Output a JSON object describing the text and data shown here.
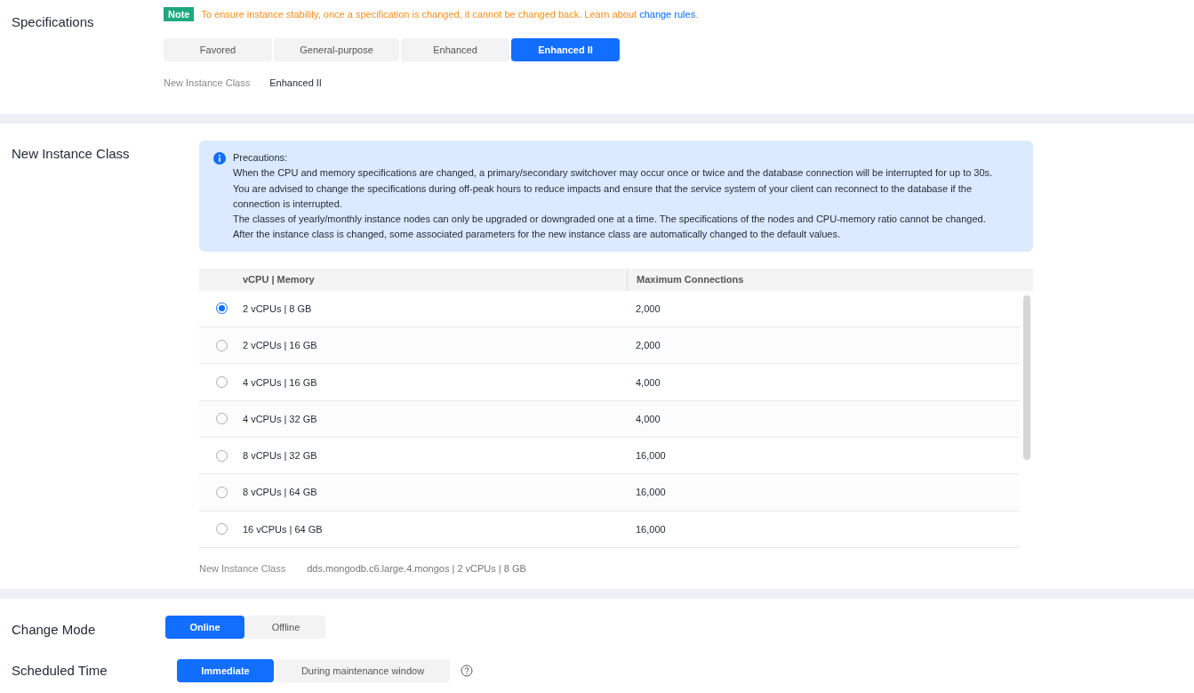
{
  "specifications": {
    "label": "Specifications",
    "note": {
      "badge": "Note",
      "text": "To ensure instance stability, once a specification is changed, it cannot be changed back. Learn about",
      "link": "change rules",
      "end": "."
    },
    "tabs": [
      {
        "label": "Favored",
        "selected": false
      },
      {
        "label": "General-purpose",
        "selected": false
      },
      {
        "label": "Enhanced",
        "selected": false
      },
      {
        "label": "Enhanced II",
        "selected": true
      }
    ],
    "summary": {
      "label": "New Instance Class",
      "value": "Enhanced II"
    }
  },
  "instance_class": {
    "label": "New Instance Class",
    "precautions": {
      "title": "Precautions:",
      "lines": [
        "When the CPU and memory specifications are changed, a primary/secondary switchover may occur once or twice and the database connection will be interrupted for up to 30s.",
        "You are advised to change the specifications during off-peak hours to reduce impacts and ensure that the service system of your client can reconnect to the database if the connection is interrupted.",
        "The classes of yearly/monthly instance nodes can only be upgraded or downgraded one at a time. The specifications of the nodes and CPU-memory ratio cannot be changed.",
        "After the instance class is changed, some associated parameters for the new instance class are automatically changed to the default values."
      ]
    },
    "table": {
      "columns": [
        "vCPU | Memory",
        "Maximum Connections"
      ],
      "rows": [
        {
          "spec": "2 vCPUs | 8 GB",
          "connections": "2,000",
          "selected": true
        },
        {
          "spec": "2 vCPUs | 16 GB",
          "connections": "2,000",
          "selected": false
        },
        {
          "spec": "4 vCPUs | 16 GB",
          "connections": "4,000",
          "selected": false
        },
        {
          "spec": "4 vCPUs | 32 GB",
          "connections": "4,000",
          "selected": false
        },
        {
          "spec": "8 vCPUs | 32 GB",
          "connections": "16,000",
          "selected": false
        },
        {
          "spec": "8 vCPUs | 64 GB",
          "connections": "16,000",
          "selected": false
        },
        {
          "spec": "16 vCPUs | 64 GB",
          "connections": "16,000",
          "selected": false
        }
      ]
    },
    "summary": {
      "label": "New Instance Class",
      "value": "dds.mongodb.c6.large.4.mongos | 2 vCPUs | 8 GB"
    }
  },
  "change_mode": {
    "label": "Change Mode",
    "options": [
      {
        "label": "Online",
        "selected": true
      },
      {
        "label": "Offline",
        "selected": false
      }
    ]
  },
  "scheduled_time": {
    "label": "Scheduled Time",
    "options": [
      {
        "label": "Immediate",
        "selected": true
      },
      {
        "label": "During maintenance window",
        "selected": false
      }
    ]
  }
}
